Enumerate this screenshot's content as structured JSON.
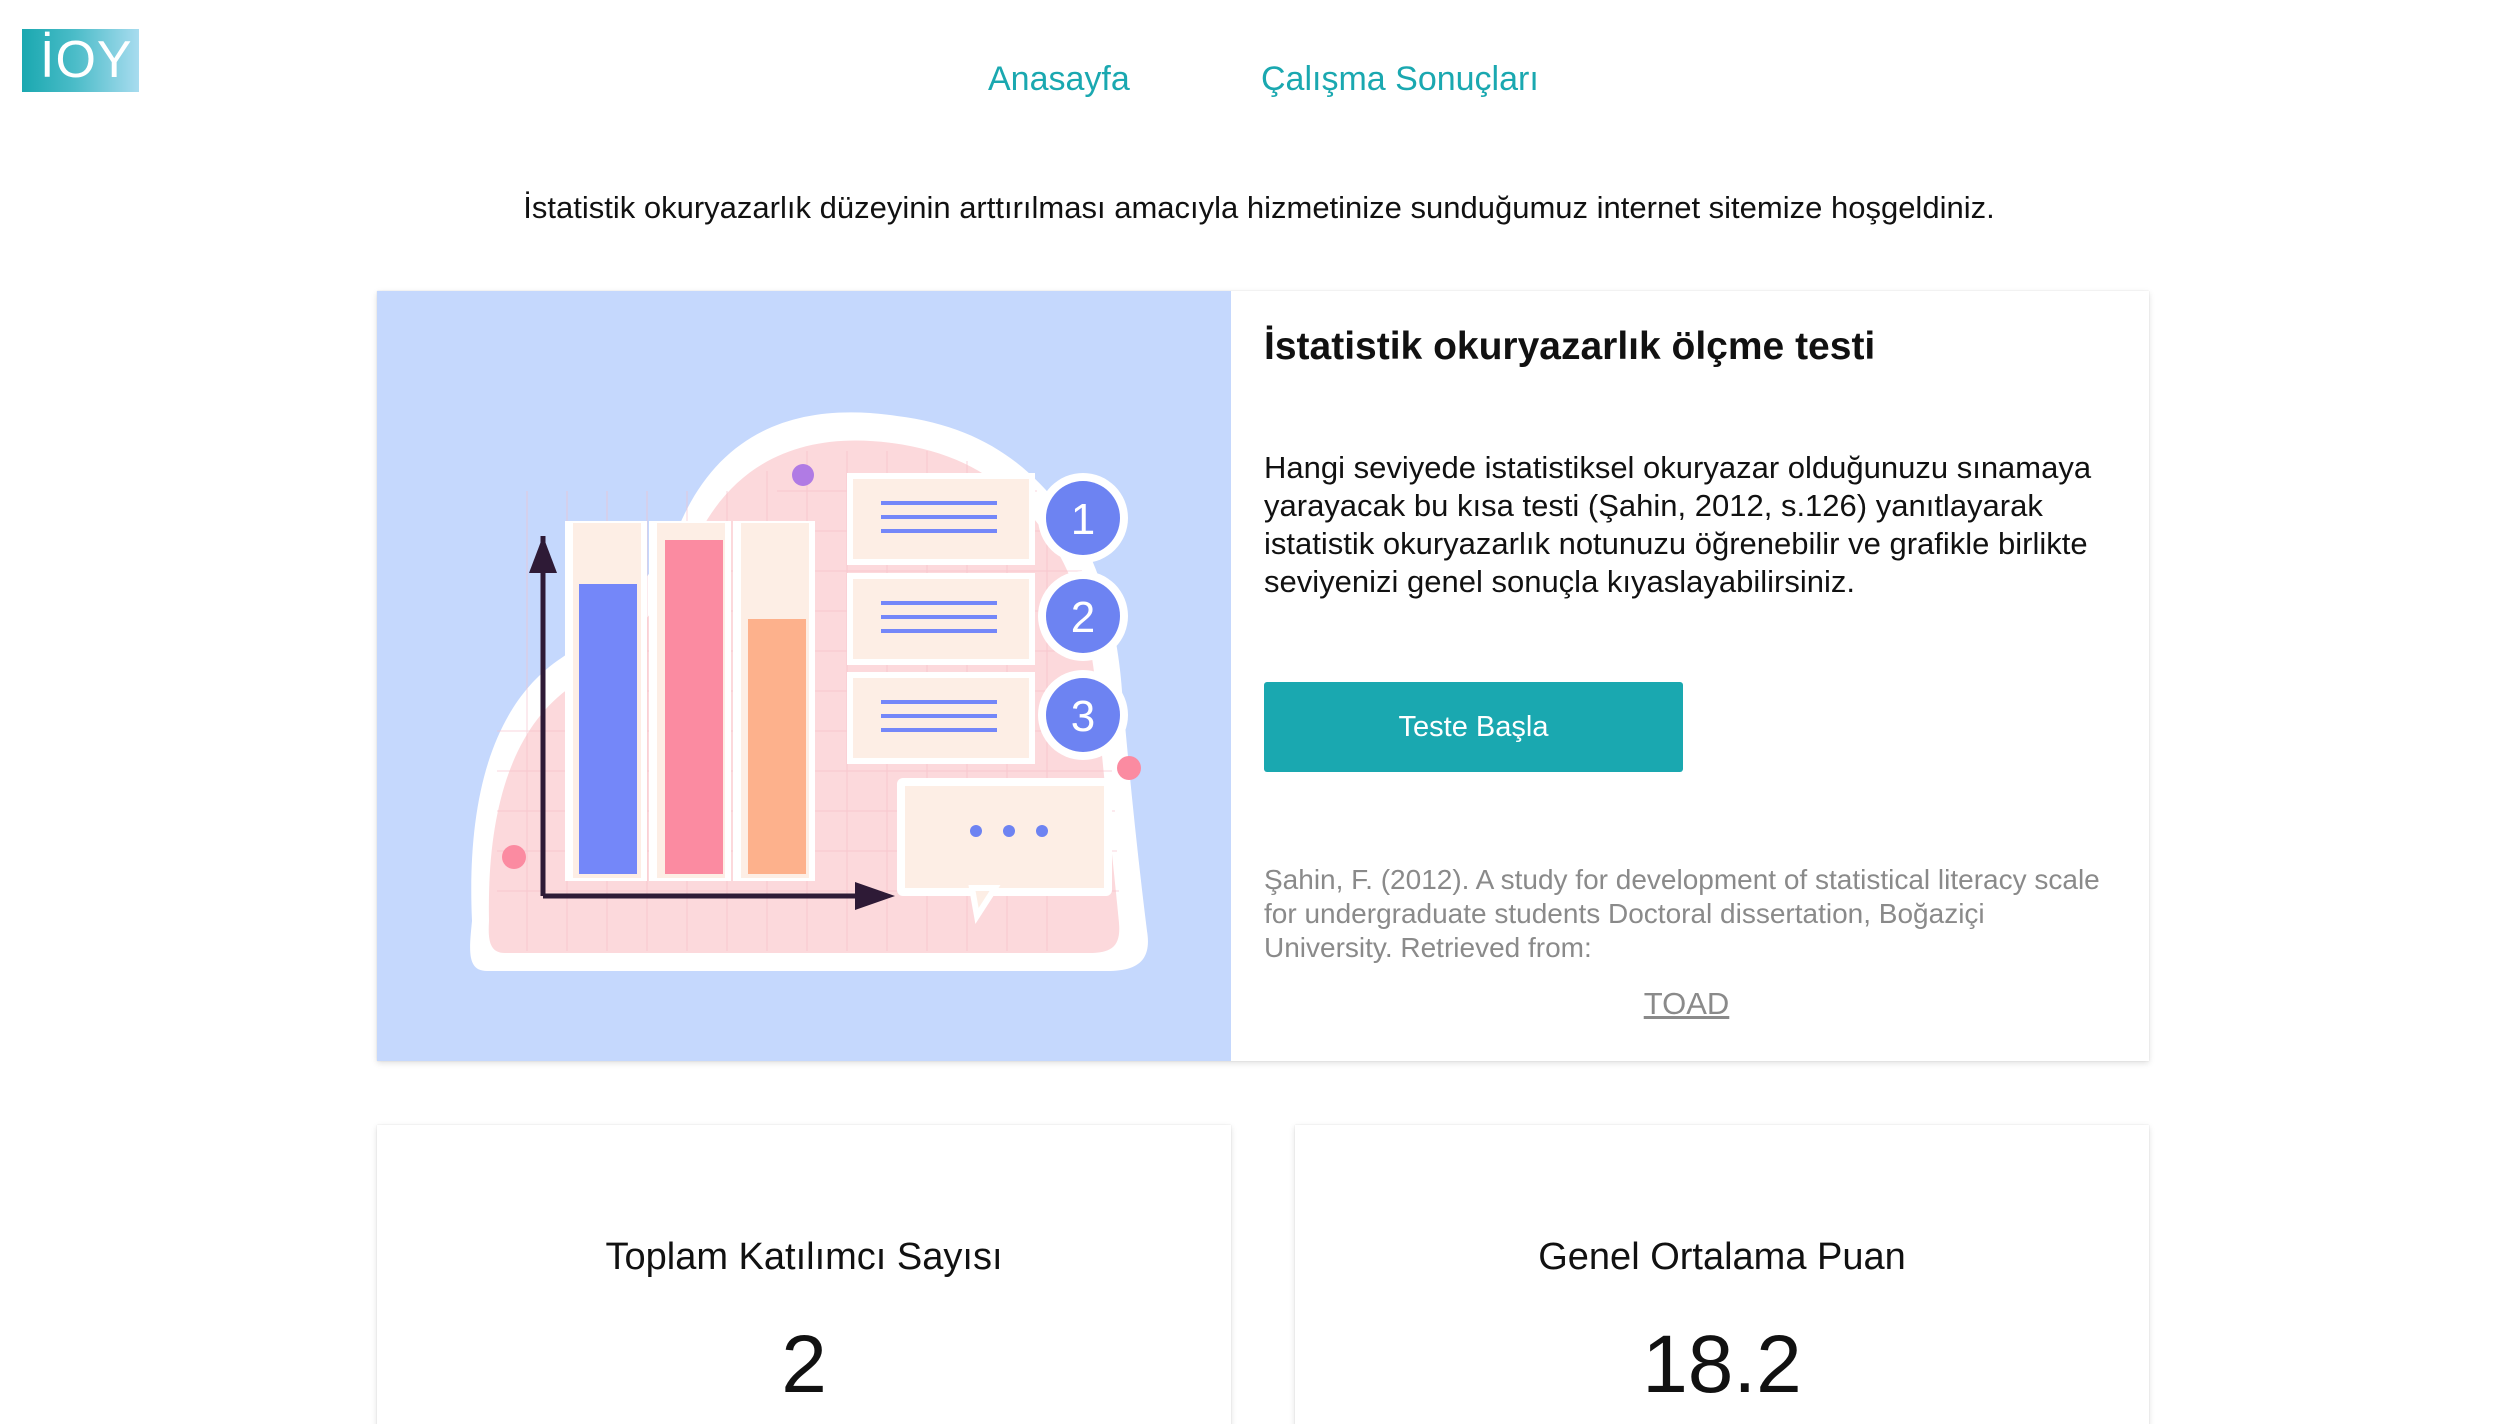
{
  "logo": {
    "text": "İOY"
  },
  "nav": {
    "home": "Anasayfa",
    "results": "Çalışma Sonuçları"
  },
  "welcome": "İstatistik okuryazarlık düzeyinin arttırılması amacıyla hizmetinize sunduğumuz internet sitemize hoşgeldiniz.",
  "hero": {
    "title": "İstatistik okuryazarlık ölçme testi",
    "description": "Hangi seviyede istatistiksel okuryazar olduğunuzu sınamaya yarayacak bu kısa testi (Şahin, 2012, s.126) yanıtlayarak istatistik okuryazarlık notunuzu öğrenebilir ve grafikle birlikte seviyenizi genel sonuçla kıyaslayabilirsiniz.",
    "start_button": "Teste Başla",
    "citation": "Şahin, F. (2012). A study for development of statistical literacy scale for undergraduate students Doctoral dissertation, Boğaziçi University. Retrieved from:",
    "link": "TOAD",
    "illustration": {
      "steps": [
        "1",
        "2",
        "3"
      ]
    }
  },
  "stats": [
    {
      "label": "Toplam Katılımcı Sayısı",
      "value": "2"
    },
    {
      "label": "Genel Ortalama Puan",
      "value": "18.2"
    }
  ],
  "colors": {
    "accent": "#1aa8b0",
    "hero_bg": "#c5d8fd",
    "bar_blue": "#7487f9",
    "bar_pink": "#fb8ba1",
    "bar_peach": "#fdb18c",
    "step_circle": "#6d83f2"
  }
}
